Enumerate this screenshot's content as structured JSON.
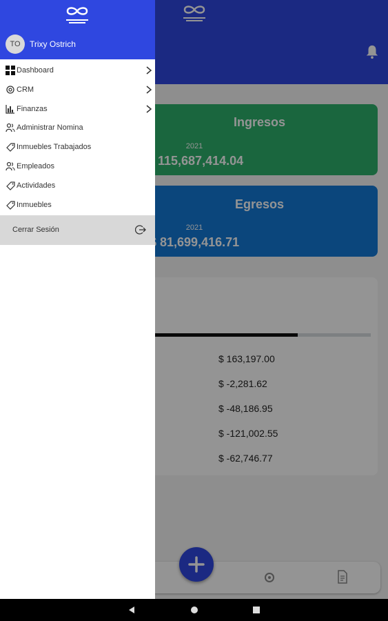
{
  "user": {
    "initials": "TO",
    "name": "Trixy Ostrich"
  },
  "menu": [
    {
      "label": "Dashboard",
      "icon": "grid-icon",
      "chevron": true
    },
    {
      "label": "CRM",
      "icon": "gear-icon",
      "chevron": true
    },
    {
      "label": "Finanzas",
      "icon": "chart-icon",
      "chevron": true
    },
    {
      "label": "Administrar Nomina",
      "icon": "people-icon",
      "chevron": false
    },
    {
      "label": "Inmuebles Trabajados",
      "icon": "tag-icon",
      "chevron": false
    },
    {
      "label": "Empleados",
      "icon": "people-icon",
      "chevron": false
    },
    {
      "label": "Actividades",
      "icon": "tag-icon",
      "chevron": false
    },
    {
      "label": "Inmuebles",
      "icon": "tag-icon",
      "chevron": false
    }
  ],
  "logout": {
    "label": "Cerrar Sesión"
  },
  "ingresos": {
    "title": "Ingresos",
    "year": "2021",
    "amount": "115,687,414.04"
  },
  "egresos": {
    "title": "Egresos",
    "year": "2021",
    "amount": "$ 81,699,416.71"
  },
  "summary": {
    "progress": 0.66,
    "values": [
      "$ 163,197.00",
      "$ -2,281.62",
      "$ -48,186.95",
      "$ -121,002.55",
      "$ -62,746.77"
    ]
  },
  "colors": {
    "primary": "#2f47e0",
    "ingresos": "#2eb06c",
    "egresos": "#1479d6"
  }
}
